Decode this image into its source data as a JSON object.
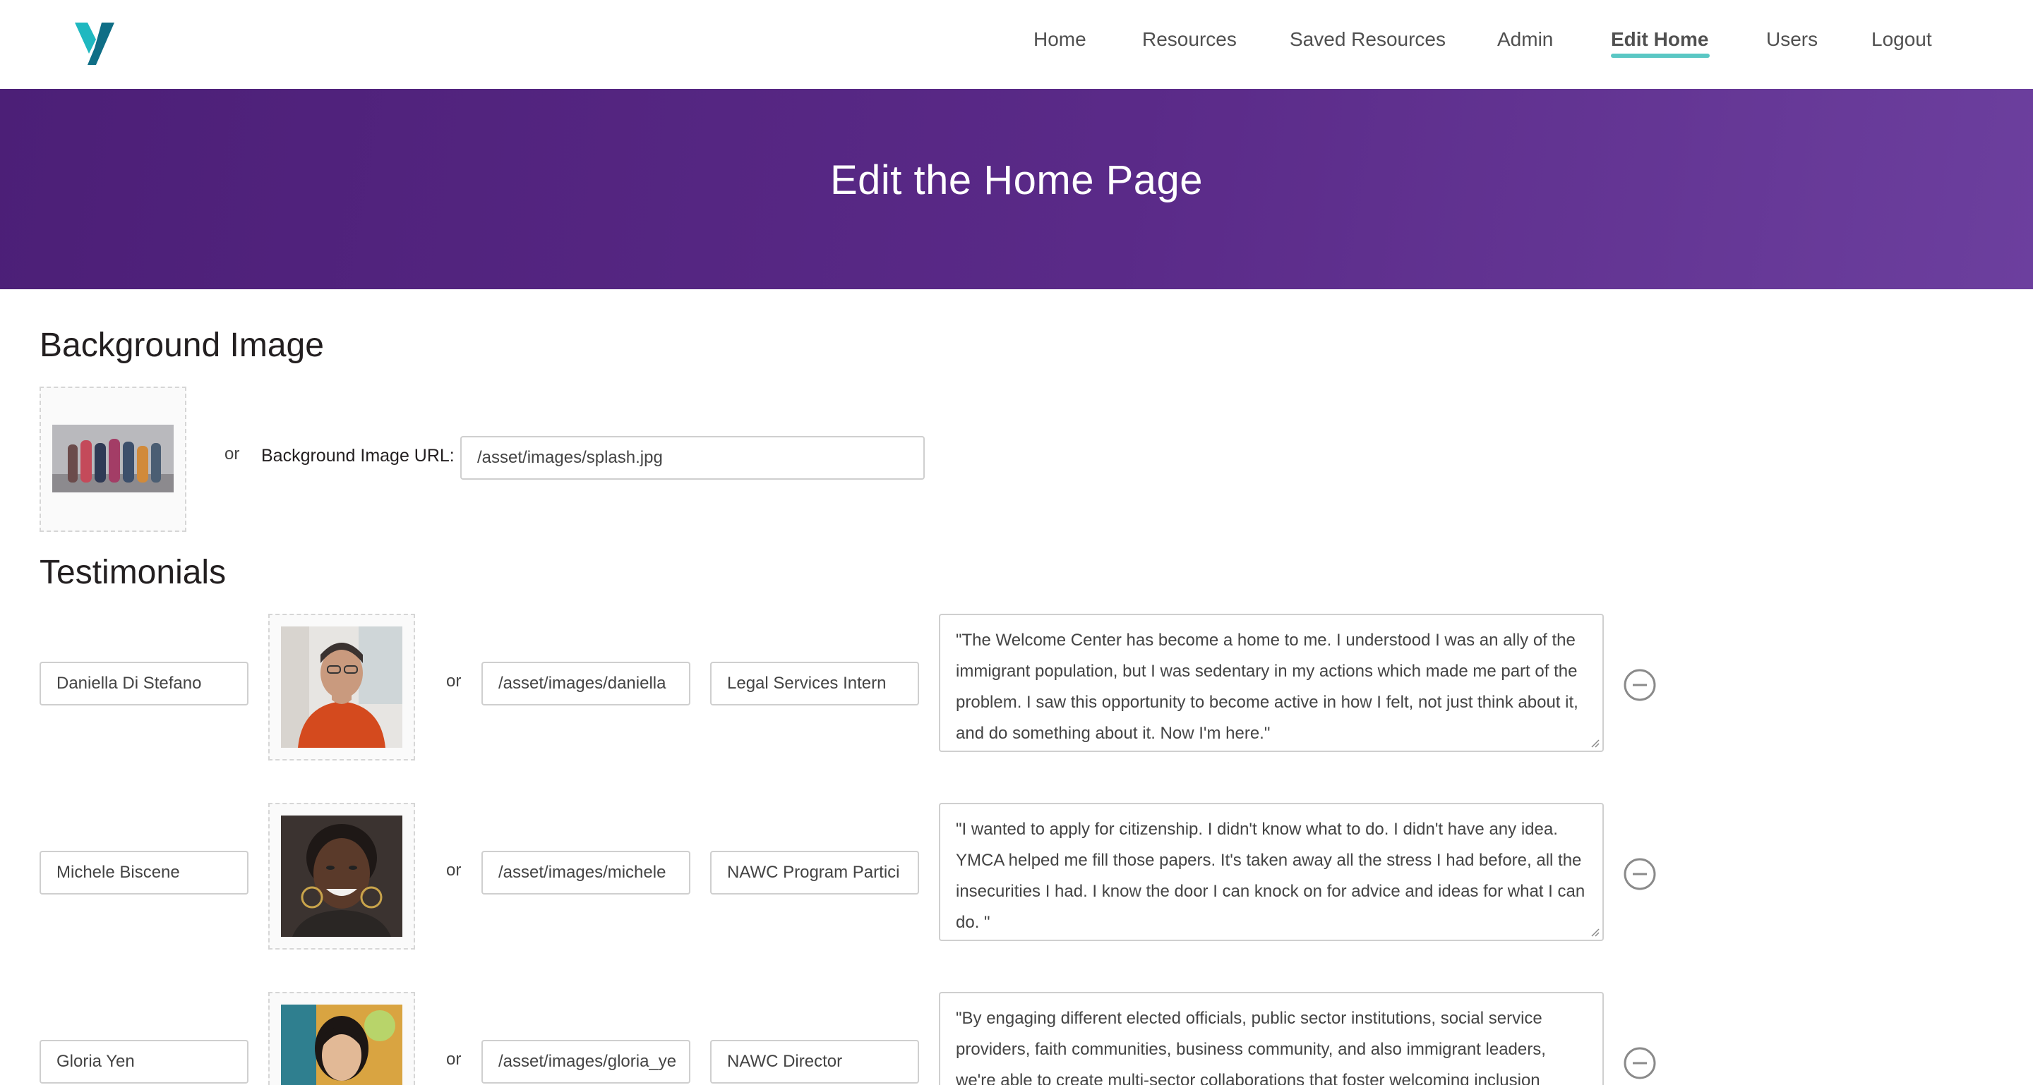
{
  "nav": {
    "items": [
      {
        "label": "Home"
      },
      {
        "label": "Resources"
      },
      {
        "label": "Saved Resources"
      },
      {
        "label": "Admin"
      },
      {
        "label": "Edit Home"
      },
      {
        "label": "Users"
      },
      {
        "label": "Logout"
      }
    ],
    "active": "Edit Home"
  },
  "banner": {
    "title": "Edit the Home Page"
  },
  "background": {
    "title": "Background Image",
    "or": "or",
    "url_label": "Background Image URL:",
    "url_value": "/asset/images/splash.jpg"
  },
  "testimonials": {
    "title": "Testimonials",
    "items": [
      {
        "name": "Daniella Di Stefano",
        "or": "or",
        "image_url": "/asset/images/daniella",
        "role": "Legal Services Intern",
        "quote": "\"The Welcome Center has become a home to me. I understood I was an ally of the immigrant population, but I was sedentary in my actions which made me part of the problem. I saw this opportunity to become active in how I felt, not just think about it, and do something about it. Now I'm here.\""
      },
      {
        "name": "Michele Biscene",
        "or": "or",
        "image_url": "/asset/images/michele",
        "role": "NAWC Program Partici",
        "quote": "\"I wanted to apply for citizenship. I didn't know what to do. I didn't have any idea. YMCA helped me fill those papers. It's taken away all the stress I had before, all the insecurities I had. I know the door I can knock on for advice and ideas for what I can do. \""
      },
      {
        "name": "Gloria Yen",
        "or": "or",
        "image_url": "/asset/images/gloria_ye",
        "role": "NAWC Director",
        "quote": "\"By engaging different elected officials, public sector institutions, social service providers, faith communities, business community, and also immigrant leaders, we're able to create multi-sector collaborations that foster welcoming inclusion"
      }
    ]
  },
  "colors": {
    "accent": "#5ac7c4",
    "banner": "#5a2a88",
    "logo_teal": "#1fb8c0",
    "logo_dark": "#0f6e86"
  },
  "icons": {
    "logo": "ymca-y-logo",
    "remove": "minus-circle-icon",
    "resize": "resize-handle-icon"
  }
}
